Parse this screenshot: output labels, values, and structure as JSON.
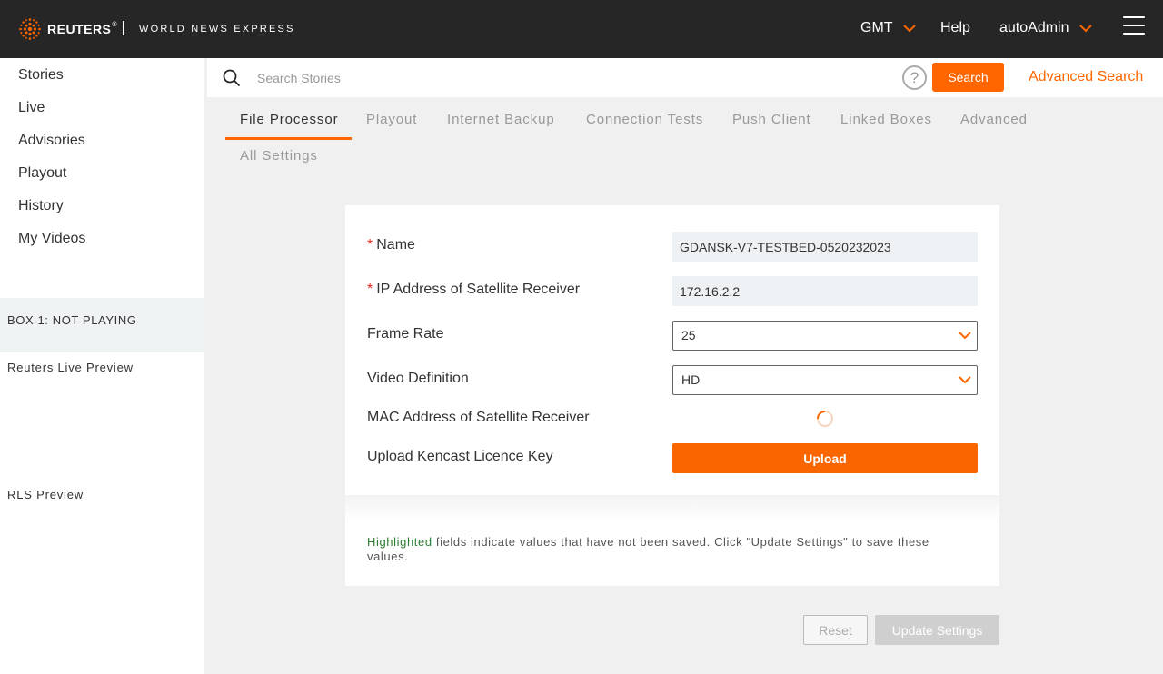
{
  "header": {
    "logo_text": "REUTERS",
    "logo_reg": "®",
    "subtitle": "WORLD NEWS EXPRESS",
    "timezone": "GMT",
    "help": "Help",
    "user": "autoAdmin"
  },
  "sidebar": {
    "items": [
      {
        "label": "Stories"
      },
      {
        "label": "Live"
      },
      {
        "label": "Advisories"
      },
      {
        "label": "Playout"
      },
      {
        "label": "History"
      },
      {
        "label": "My Videos"
      }
    ],
    "box_status": "BOX 1: NOT PLAYING",
    "live_preview": "Reuters Live Preview",
    "rls_preview": "RLS Preview"
  },
  "search": {
    "placeholder": "Search Stories",
    "help_glyph": "?",
    "button": "Search",
    "advanced": "Advanced Search"
  },
  "tabs": [
    {
      "label": "File Processor",
      "active": true
    },
    {
      "label": "Playout"
    },
    {
      "label": "Internet Backup"
    },
    {
      "label": "Connection Tests"
    },
    {
      "label": "Push Client"
    },
    {
      "label": "Linked Boxes"
    },
    {
      "label": "Advanced"
    },
    {
      "label": "All Settings"
    }
  ],
  "form": {
    "required_mark": "*",
    "name_label": "Name",
    "name_value": "GDANSK-V7-TESTBED-0520232023",
    "ip_label": "IP Address of Satellite Receiver",
    "ip_value": "172.16.2.2",
    "frame_rate_label": "Frame Rate",
    "frame_rate_value": "25",
    "video_def_label": "Video Definition",
    "video_def_value": "HD",
    "mac_label": "MAC Address of Satellite Receiver",
    "kencast_label": "Upload Kencast Licence Key",
    "upload_button": "Upload"
  },
  "note": {
    "highlight": "Highlighted",
    "text": " fields indicate values that have not been saved. Click \"Update Settings\" to save these values."
  },
  "actions": {
    "reset": "Reset",
    "update": "Update Settings"
  },
  "colors": {
    "accent": "#ff6600",
    "topbar": "#262626",
    "required": "#e8281e",
    "highlight": "#2e7d32"
  }
}
